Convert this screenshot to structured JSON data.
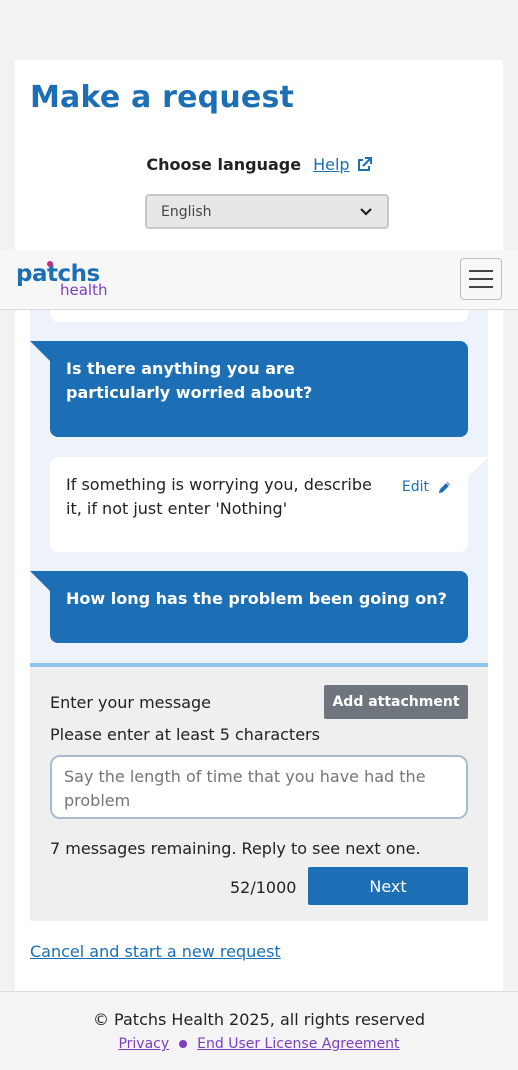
{
  "page": {
    "title": "Make a request",
    "language_label": "Choose language",
    "help_link": "Help",
    "language_select": {
      "value": "English"
    }
  },
  "navbar": {
    "logo_top": "patchs",
    "logo_bottom": "health"
  },
  "chat": {
    "question_1": "Is there anything you are particularly worried about?",
    "answer_1": "If something is worrying you, describe it, if not just enter 'Nothing'",
    "edit_label": "Edit",
    "question_2": "How long has the problem been going on?"
  },
  "compose": {
    "enter_label": "Enter your message",
    "attach_label": "Add attachment",
    "min_chars_label": "Please enter at least 5 characters",
    "input_placeholder": "Say the length of time that you have had the problem",
    "remaining_text": "7 messages remaining. Reply to see next one.",
    "counter": "52/1000",
    "next_label": "Next"
  },
  "cancel_link": "Cancel and start a new request",
  "footer": {
    "copyright": "© Patchs Health 2025, all rights reserved",
    "privacy": "Privacy",
    "eula": "End User License Agreement"
  },
  "colors": {
    "brand_blue": "#1c6fb5",
    "brand_purple": "#7b3fbf",
    "chat_background": "#eef3fb"
  },
  "icons": [
    "external-link-icon",
    "chevron-down-icon",
    "menu-icon",
    "pencil-icon"
  ]
}
